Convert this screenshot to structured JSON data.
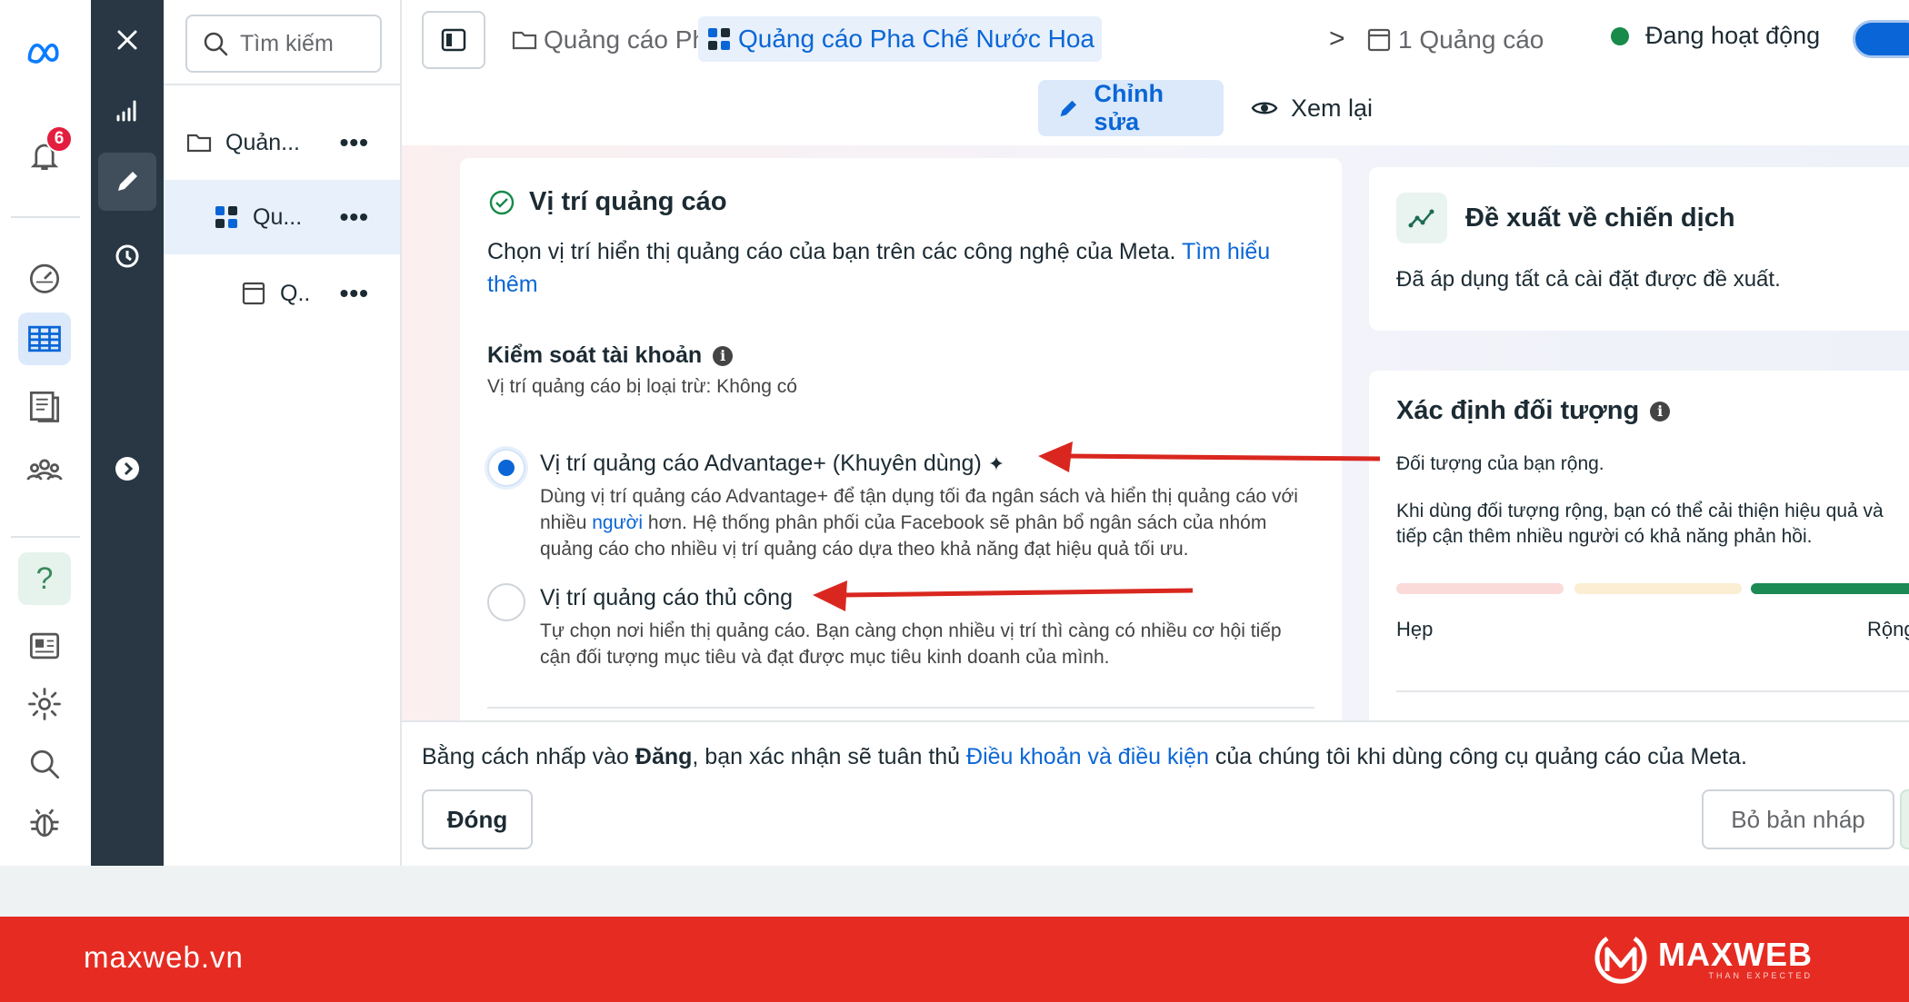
{
  "rail": {
    "notification_count": "6",
    "icons": [
      "meta-logo-icon",
      "bell-icon",
      "dashboard-gauge-icon",
      "campaigns-table-icon",
      "pages-icon",
      "audiences-icon",
      "help-icon",
      "news-icon",
      "settings-icon",
      "search-icon",
      "bug-icon"
    ]
  },
  "tree": {
    "search_placeholder": "Tìm kiếm",
    "items": [
      {
        "label": "Quản...",
        "icon": "folder-icon"
      },
      {
        "label": "Qu...",
        "icon": "ad-set-icon"
      },
      {
        "label": "Q..",
        "icon": "ad-icon"
      }
    ],
    "more": "•••"
  },
  "breadcrumb": {
    "campaign": "Quảng cáo Pha Chế Nước Hoa",
    "ad_set": "Quảng cáo Pha Chế Nước Hoa",
    "ads": "1 Quảng cáo",
    "separator": ">"
  },
  "status": {
    "label": "Đang hoạt động",
    "color": "#188a4a"
  },
  "tabs": {
    "edit": "Chỉnh sửa",
    "review": "Xem lại"
  },
  "placement": {
    "title": "Vị trí quảng cáo",
    "desc": "Chọn vị trí hiển thị quảng cáo của bạn trên các công nghệ của Meta.",
    "learn_more": "Tìm hiểu thêm",
    "account_control": "Kiểm soát tài khoản",
    "excluded": "Vị trí quảng cáo bị loại trừ: Không có",
    "options": [
      {
        "title": "Vị trí quảng cáo Advantage+ (Khuyên dùng)",
        "desc_a": "Dùng vị trí quảng cáo Advantage+ để tận dụng tối đa ngân sách và hiển thị quảng cáo với nhiều ",
        "desc_link": "người",
        "desc_b": " hơn. Hệ thống phân phối của Facebook sẽ phân bổ ngân sách của nhóm quảng cáo cho nhiều vị trí quảng cáo dựa theo khả năng đạt hiệu quả tối ưu.",
        "selected": true
      },
      {
        "title": "Vị trí quảng cáo thủ công",
        "desc": "Tự chọn nơi hiển thị quảng cáo. Bạn càng chọn nhiều vị trí thì càng có nhiều cơ hội tiếp cận đối tượng mục tiêu và đạt được mục tiêu kinh doanh của mình.",
        "selected": false
      }
    ]
  },
  "suggestions": {
    "title": "Đề xuất về chiến dịch",
    "text": "Đã áp dụng tất cả cài đặt được đề xuất."
  },
  "audience": {
    "title": "Xác định đối tượng",
    "broad": "Đối tượng của bạn rộng.",
    "hint": "Khi dùng đối tượng rộng, bạn có thể cải thiện hiệu quả và tiếp cận thêm nhiều người có khả năng phản hồi.",
    "narrow": "Hẹp",
    "wide": "Rộng",
    "level": "broad"
  },
  "footer": {
    "consent_a": "Bằng cách nhấp vào ",
    "consent_bold": "Đăng",
    "consent_b": ", bạn xác nhận sẽ tuân thủ ",
    "consent_link": "Điều khoản và điều kiện",
    "consent_c": " của chúng tôi khi dùng công cụ quảng cáo của Meta.",
    "close": "Đóng",
    "discard": "Bỏ bản nháp"
  },
  "branding": {
    "site": "maxweb.vn",
    "brand": "MAXWEB",
    "tagline": "THAN EXPECTED",
    "bar_color": "#e62c22"
  },
  "annotation_color": "#d9271f"
}
